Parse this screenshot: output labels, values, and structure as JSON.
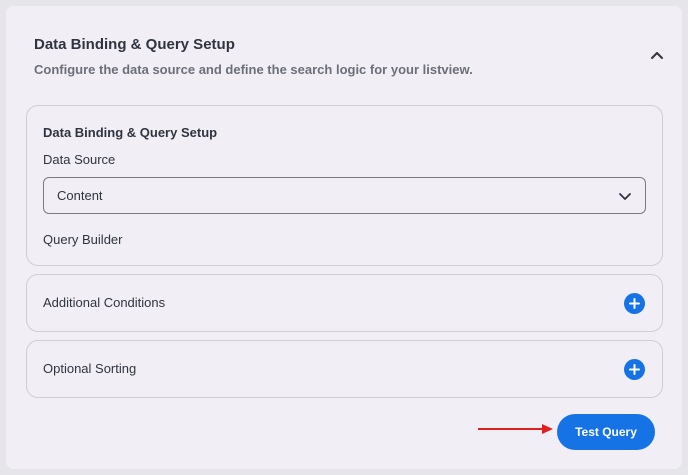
{
  "section": {
    "title": "Data Binding & Query Setup",
    "subtitle": "Configure the data source and define the search logic for your listview.",
    "collapse_icon": "chevron-up-icon"
  },
  "binding_card": {
    "title": "Data Binding & Query Setup",
    "data_source_label": "Data Source",
    "data_source_value": "Content",
    "query_builder_label": "Query Builder"
  },
  "additional_conditions": {
    "label": "Additional Conditions",
    "icon": "plus-circle-icon"
  },
  "optional_sorting": {
    "label": "Optional Sorting",
    "icon": "plus-circle-icon"
  },
  "actions": {
    "test_query_label": "Test Query"
  },
  "colors": {
    "accent": "#1673e6",
    "annotation_arrow": "#e02020"
  }
}
